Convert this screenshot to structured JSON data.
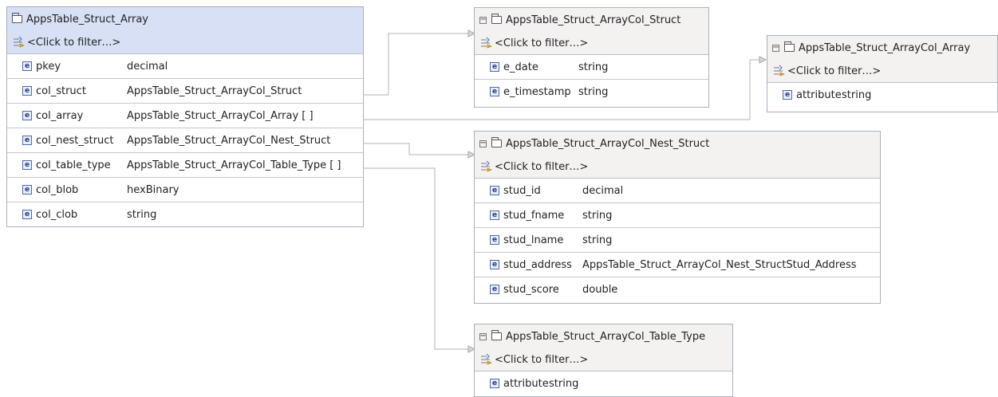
{
  "filter_text": "<Click to filter…>",
  "boxes": [
    {
      "id": "struct-array",
      "title": "AppsTable_Struct_Array",
      "fields": [
        {
          "name": "pkey",
          "type": "decimal"
        },
        {
          "name": "col_struct",
          "type": "AppsTable_Struct_ArrayCol_Struct"
        },
        {
          "name": "col_array",
          "type": "AppsTable_Struct_ArrayCol_Array [ ]"
        },
        {
          "name": "col_nest_struct",
          "type": "AppsTable_Struct_ArrayCol_Nest_Struct"
        },
        {
          "name": "col_table_type",
          "type": "AppsTable_Struct_ArrayCol_Table_Type [ ]"
        },
        {
          "name": "col_blob",
          "type": "hexBinary"
        },
        {
          "name": "col_clob",
          "type": "string"
        }
      ]
    },
    {
      "id": "arraycol-struct",
      "title": "AppsTable_Struct_ArrayCol_Struct",
      "fields": [
        {
          "name": "e_date",
          "type": "string"
        },
        {
          "name": "e_timestamp",
          "type": "string"
        }
      ]
    },
    {
      "id": "arraycol-array",
      "title": "AppsTable_Struct_ArrayCol_Array",
      "fields": [
        {
          "name": "attribute",
          "type": "string"
        }
      ]
    },
    {
      "id": "arraycol-nest-struct",
      "title": "AppsTable_Struct_ArrayCol_Nest_Struct",
      "fields": [
        {
          "name": "stud_id",
          "type": "decimal"
        },
        {
          "name": "stud_fname",
          "type": "string"
        },
        {
          "name": "stud_lname",
          "type": "string"
        },
        {
          "name": "stud_address",
          "type": "AppsTable_Struct_ArrayCol_Nest_StructStud_Address"
        },
        {
          "name": "stud_score",
          "type": "double"
        }
      ]
    },
    {
      "id": "arraycol-table-type",
      "title": "AppsTable_Struct_ArrayCol_Table_Type",
      "fields": [
        {
          "name": "attribute",
          "type": "string"
        }
      ]
    }
  ],
  "colors": {
    "root_header": "#d7e0f4",
    "child_header": "#f4f1f1",
    "border": "#a9b0bd",
    "connector": "#b3b3b3"
  }
}
